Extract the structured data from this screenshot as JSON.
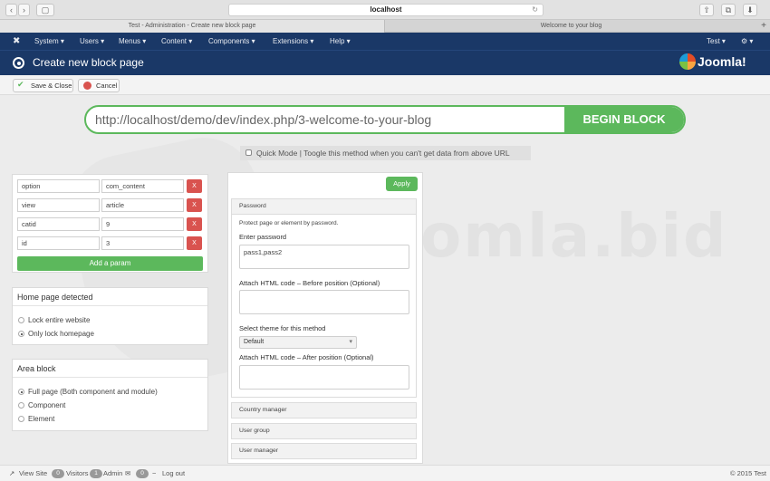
{
  "browser": {
    "url": "localhost",
    "tabs": [
      "Test - Administration - Create new block page",
      "Welcome to your blog"
    ],
    "new_tab": "+"
  },
  "nav": {
    "menus": [
      "System",
      "Users",
      "Menus",
      "Content",
      "Components",
      "Extensions",
      "Help"
    ],
    "user": "Test",
    "settings_icon": "gear-icon"
  },
  "header": {
    "title": "Create new block page",
    "logo": "Joomla!"
  },
  "toolbar": {
    "save_close": "Save & Close",
    "cancel": "Cancel"
  },
  "watermark": "Joomla.bid",
  "url_input": {
    "value": "http://localhost/demo/dev/index.php/3-welcome-to-your-blog",
    "button": "BEGIN BLOCK"
  },
  "quick_mode": "Quick Mode | Toogle this method when you can't get data from above URL",
  "params": {
    "rows": [
      {
        "key": "option",
        "value": "com_content",
        "remove": "X"
      },
      {
        "key": "view",
        "value": "article",
        "remove": "X"
      },
      {
        "key": "catid",
        "value": "9",
        "remove": "X"
      },
      {
        "key": "id",
        "value": "3",
        "remove": "X"
      }
    ],
    "add_label": "Add a param"
  },
  "home_detected": {
    "title": "Home page detected",
    "options": [
      "Lock entire website",
      "Only lock homepage"
    ],
    "selected": 1
  },
  "area_block": {
    "title": "Area block",
    "options": [
      "Full page (Both component and module)",
      "Component",
      "Element"
    ],
    "selected": 0
  },
  "method": {
    "apply": "Apply",
    "password_section": "Password",
    "description": "Protect page or element by password.",
    "password_label": "Enter password",
    "password_value": "pass1,pass2",
    "before_label": "Attach HTML code – Before position (Optional)",
    "theme_label": "Select theme for this method",
    "theme_value": "Default",
    "after_label": "Attach HTML code – After position (Optional)",
    "sections": [
      "Country manager",
      "User group",
      "User manager"
    ]
  },
  "status": {
    "view_site": "View Site",
    "visitors_count": "0",
    "visitors": "Visitors",
    "admin_count": "1",
    "admin": "Admin",
    "messages_count": "0",
    "logout": "Log out",
    "copyright": "© 2015 Test"
  },
  "colors": {
    "nav": "#1a3867",
    "success": "#5cb85c",
    "danger": "#d9534f"
  }
}
